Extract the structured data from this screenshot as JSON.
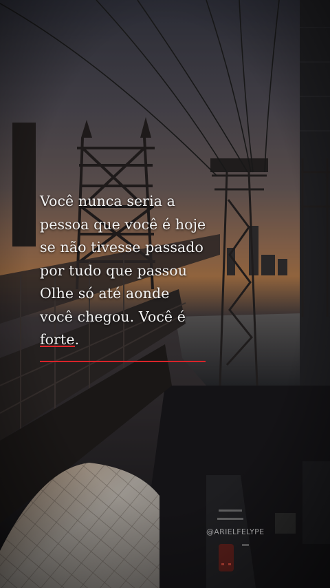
{
  "quote": {
    "lines": [
      "Você nunca seria a",
      "pessoa que você é hoje",
      "se não tivesse passado",
      "por tudo que passou",
      "Olhe só até aonde",
      "você chegou. Você é"
    ],
    "last_word": "forte",
    "last_punct": "."
  },
  "watermark": "@ARIELFELYPE",
  "colors": {
    "accent": "#d8242a",
    "text": "#f2f2f2"
  }
}
